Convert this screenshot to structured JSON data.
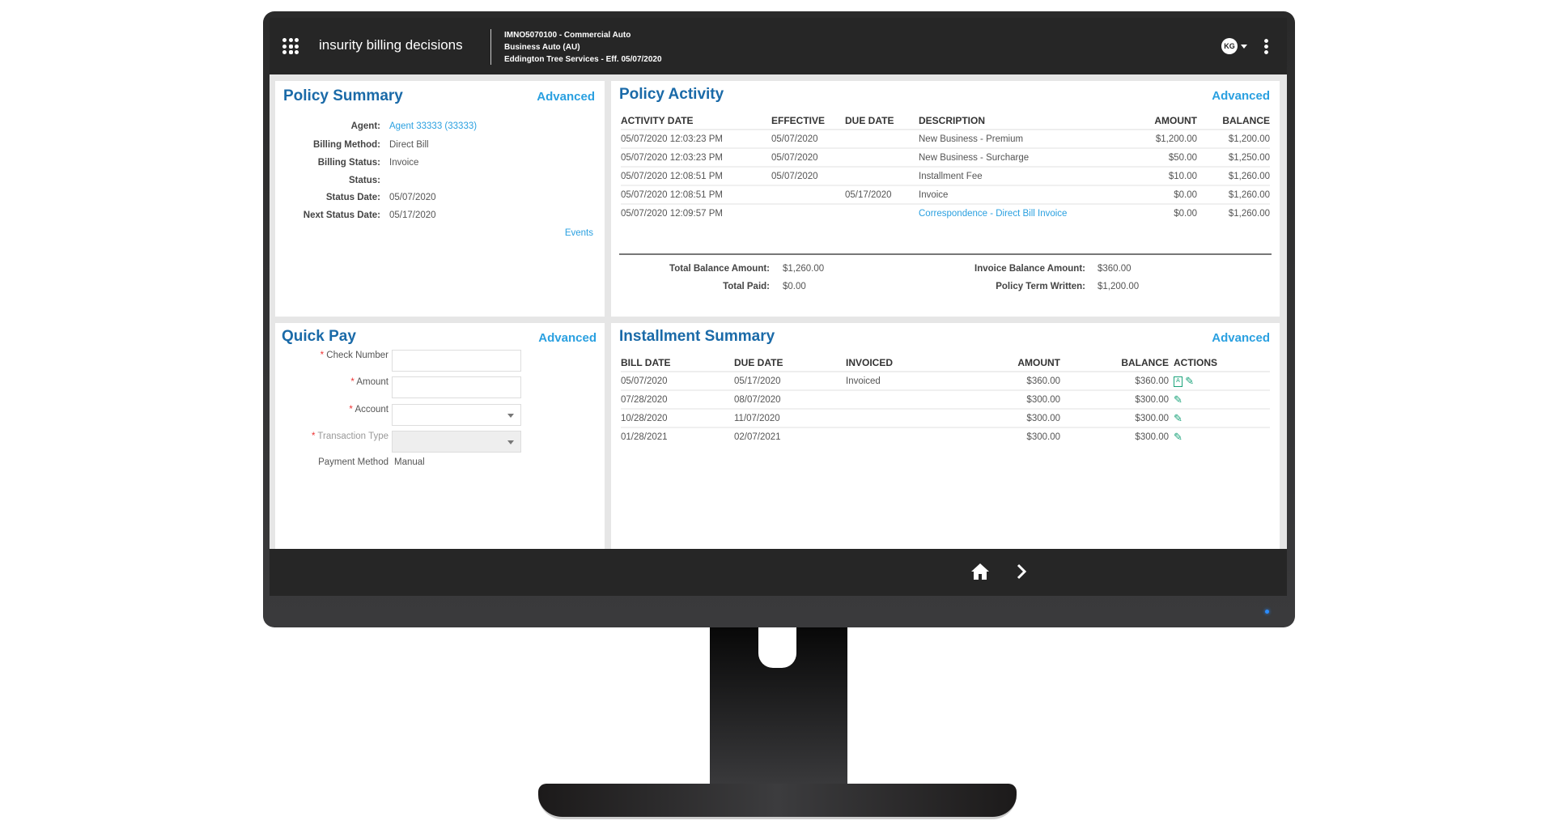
{
  "header": {
    "app_name": "insurity billing decisions",
    "policy_line1": "IMNO5070100 - Commercial Auto",
    "policy_line2": "Business Auto (AU)",
    "policy_line3": "Eddington Tree Services - Eff. 05/07/2020",
    "user_initials": "KG"
  },
  "policy_summary": {
    "title": "Policy Summary",
    "advanced": "Advanced",
    "fields": [
      {
        "label": "Agent:",
        "value": "Agent 33333 (33333)"
      },
      {
        "label": "Billing Method:",
        "value": "Direct Bill"
      },
      {
        "label": "Billing Status:",
        "value": "Invoice"
      },
      {
        "label": "Status:",
        "value": ""
      },
      {
        "label": "Status Date:",
        "value": "05/07/2020"
      },
      {
        "label": "Next Status Date:",
        "value": "05/17/2020"
      }
    ],
    "events": "Events"
  },
  "policy_activity": {
    "title": "Policy Activity",
    "advanced": "Advanced",
    "columns": [
      "ACTIVITY DATE",
      "EFFECTIVE",
      "DUE DATE",
      "DESCRIPTION",
      "AMOUNT",
      "BALANCE"
    ],
    "rows": [
      [
        "05/07/2020 12:03:23 PM",
        "05/07/2020",
        "",
        "New Business - Premium",
        "$1,200.00",
        "$1,200.00"
      ],
      [
        "05/07/2020 12:03:23 PM",
        "05/07/2020",
        "",
        "New Business - Surcharge",
        "$50.00",
        "$1,250.00"
      ],
      [
        "05/07/2020 12:08:51 PM",
        "05/07/2020",
        "",
        "Installment Fee",
        "$10.00",
        "$1,260.00"
      ],
      [
        "05/07/2020 12:08:51 PM",
        "",
        "05/17/2020",
        "Invoice",
        "$0.00",
        "$1,260.00"
      ],
      [
        "05/07/2020 12:09:57 PM",
        "",
        "",
        "Correspondence - Direct Bill Invoice",
        "$0.00",
        "$1,260.00"
      ]
    ],
    "totals": {
      "total_balance_label": "Total Balance Amount:",
      "total_balance": "$1,260.00",
      "total_paid_label": "Total Paid:",
      "total_paid": "$0.00",
      "invoice_balance_label": "Invoice Balance Amount:",
      "invoice_balance": "$360.00",
      "term_written_label": "Policy Term Written:",
      "term_written": "$1,200.00"
    }
  },
  "quick_pay": {
    "title": "Quick Pay",
    "advanced": "Advanced",
    "check_number_label": "Check Number",
    "amount_label": "Amount",
    "account_label": "Account",
    "transaction_type_label": "Transaction Type",
    "payment_method_label": "Payment Method",
    "payment_method": "Manual",
    "required_mark": "*"
  },
  "installment_summary": {
    "title": "Installment Summary",
    "advanced": "Advanced",
    "columns": [
      "BILL DATE",
      "DUE DATE",
      "INVOICED",
      "AMOUNT",
      "BALANCE",
      "ACTIONS"
    ],
    "rows": [
      [
        "05/07/2020",
        "05/17/2020",
        "Invoiced",
        "$360.00",
        "$360.00"
      ],
      [
        "07/28/2020",
        "08/07/2020",
        "",
        "$300.00",
        "$300.00"
      ],
      [
        "10/28/2020",
        "11/07/2020",
        "",
        "$300.00",
        "$300.00"
      ],
      [
        "01/28/2021",
        "02/07/2021",
        "",
        "$300.00",
        "$300.00"
      ]
    ]
  },
  "colors": {
    "title": "#1a6aa8",
    "link": "#2aa0e0",
    "action": "#1aa37a",
    "header_bg": "#262626"
  }
}
